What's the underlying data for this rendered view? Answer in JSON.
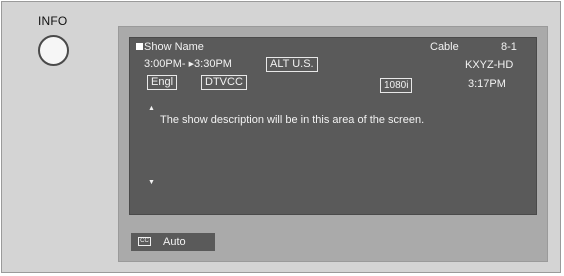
{
  "remote": {
    "info_label": "INFO"
  },
  "osd": {
    "show_name": "Show Name",
    "time_start": "3:00PM-",
    "time_end": "3:30PM",
    "rating": "ALT U.S.",
    "audio_language": "Engl",
    "caption_service": "DTVCC",
    "resolution": "1080i",
    "source": "Cable",
    "channel_number": "8-1",
    "station": "KXYZ-HD",
    "clock": "3:17PM",
    "description": "The show description will be in this area of the screen."
  },
  "caption_bar": {
    "icon_text": "CC",
    "mode": "Auto"
  }
}
